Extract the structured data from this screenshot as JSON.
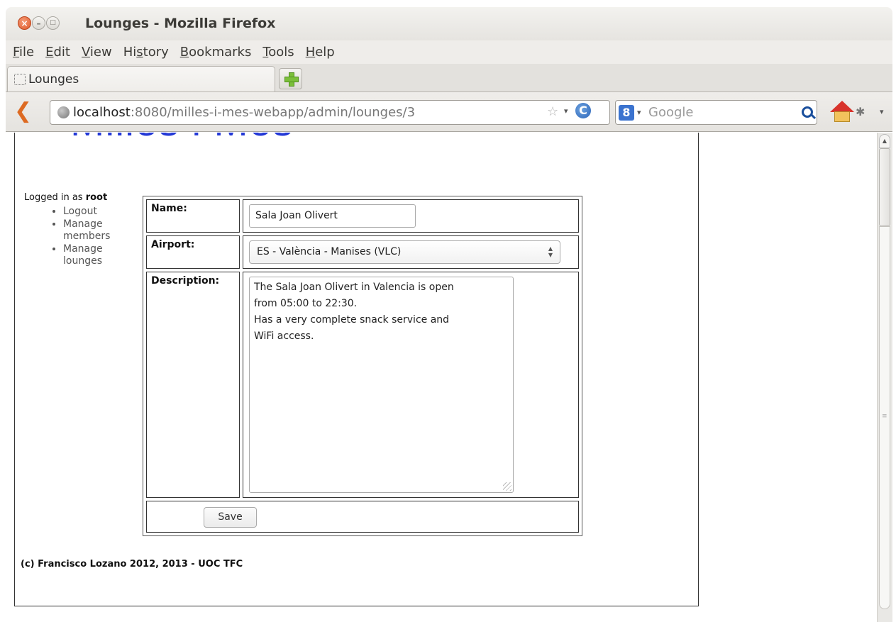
{
  "window": {
    "title": "Lounges - Mozilla Firefox",
    "close_glyph": "×",
    "min_glyph": "–",
    "max_glyph": "□"
  },
  "menubar": {
    "items": [
      {
        "key": "F",
        "rest": "ile"
      },
      {
        "key": "E",
        "rest": "dit"
      },
      {
        "key": "V",
        "rest": "iew"
      },
      {
        "pre": "Hi",
        "key": "s",
        "rest": "tory"
      },
      {
        "key": "B",
        "rest": "ookmarks"
      },
      {
        "key": "T",
        "rest": "ools"
      },
      {
        "key": "H",
        "rest": "elp"
      }
    ]
  },
  "tab": {
    "label": "Lounges"
  },
  "urlbar": {
    "host": "localhost",
    "rest": ":8080/milles-i-mes-webapp/admin/lounges/3",
    "back_glyph": "❮",
    "star_glyph": "☆",
    "dropdown_glyph": "▾",
    "reload_glyph": "C"
  },
  "searchbar": {
    "engine_glyph": "8",
    "placeholder": "Google",
    "dropdown_glyph": "▾"
  },
  "addon_glyph": "✱",
  "page": {
    "logo_text": "Milles i Mes",
    "logged_in_prefix": "Logged in as ",
    "username": "root",
    "nav": [
      {
        "label": "Logout"
      },
      {
        "label": "Manage members"
      },
      {
        "label": "Manage lounges"
      }
    ],
    "form": {
      "name_label": "Name:",
      "name_value": "Sala Joan Olivert",
      "airport_label": "Airport:",
      "airport_value": "ES - València - Manises (VLC)",
      "description_label": "Description:",
      "description_value": "The Sala Joan Olivert in Valencia is open\nfrom 05:00 to 22:30.\nHas a very complete snack service and\nWiFi access.",
      "save_label": "Save"
    },
    "footer": "(c) Francisco Lozano 2012, 2013 - UOC TFC"
  },
  "scrollbar": {
    "up_glyph": "▲",
    "grip_glyph": "≡"
  }
}
